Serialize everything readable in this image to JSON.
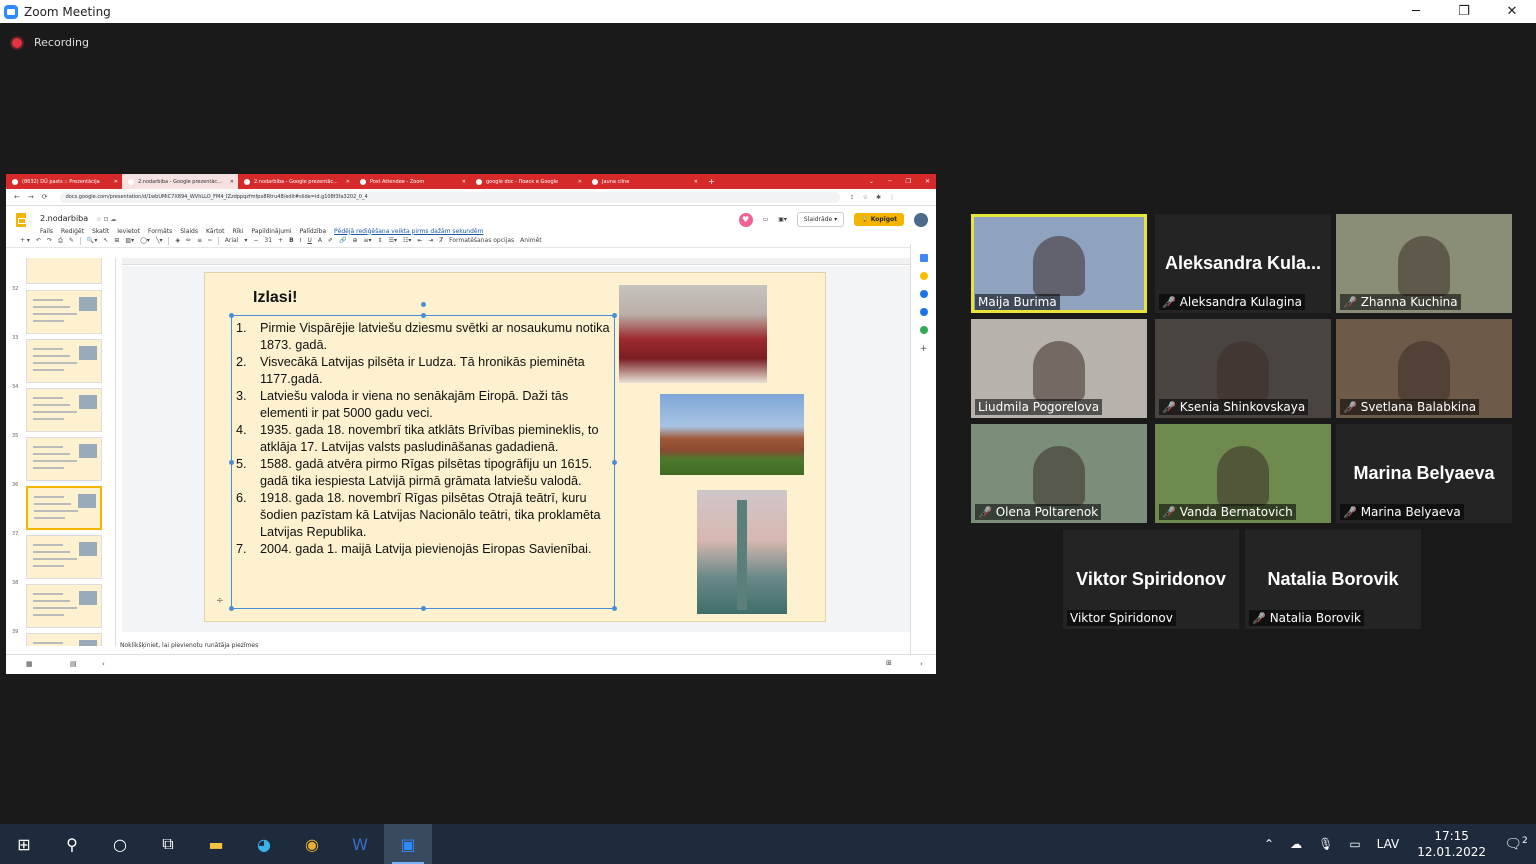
{
  "window": {
    "title": "Zoom Meeting",
    "minimize": "─",
    "restore": "❐",
    "close": "✕"
  },
  "recording": {
    "label": "Recording"
  },
  "browser": {
    "tabs": [
      {
        "label": "(8632) DŪ pasts :: Prezentācija",
        "active": false
      },
      {
        "label": "2.nodarbiba - Google prezentāc...",
        "active": true
      },
      {
        "label": "2.nodarbiba - Google prezentāc...",
        "active": false
      },
      {
        "label": "Post Attendee - Zoom",
        "active": false
      },
      {
        "label": "google doc - Поиск в Google",
        "active": false
      },
      {
        "label": "Jauna cilne",
        "active": false
      }
    ],
    "new_tab": "+",
    "url": "docs.google.com/presentation/d/1wbUMiC7X894_WVhLLO_FM4_IZzdppqzfmfpx8Rtru48/edit#slide=id.g108f3fa3202_0_4"
  },
  "doc": {
    "name": "2.nodarbiba",
    "menus": [
      "Fails",
      "Rediģēt",
      "Skatīt",
      "Ievietot",
      "Formāts",
      "Slaids",
      "Kārtot",
      "Rīki",
      "Papildinājumi",
      "Palīdzība"
    ],
    "last_edit": "Pēdējā rediģēšana veikta pirms dažām sekundēm",
    "slideshow_label": "Slaidrāde",
    "share_label": "Kopīgot",
    "toolbar": {
      "font": "Arial",
      "size": "31",
      "format_options": "Formatēšanas opcijas",
      "animate": "Animēt"
    },
    "notes_placeholder": "Noklikšķiniet, lai pievienotu runātāja piezīmes",
    "thumb_numbers": [
      "32",
      "33",
      "34",
      "35",
      "36",
      "37",
      "38",
      "39"
    ]
  },
  "slide": {
    "title": "Izlasi!",
    "items": [
      {
        "n": "1.",
        "text": "Pirmie Vispārējie latviešu dziesmu svētki ar nosaukumu notika 1873. gadā."
      },
      {
        "n": "2.",
        "text": "Visvecākā Latvijas pilsēta ir Ludza. Tā hronikās pieminēta 1177.gadā."
      },
      {
        "n": "3.",
        "text": "Latviešu valoda ir viena no senākajām Eiropā. Daži tās elementi ir pat 5000 gadu veci."
      },
      {
        "n": "4.",
        "text": "1935. gada 18. novembrī tika atklāts Brīvības piemineklis, to atklāja 17. Latvijas valsts pasludināšanas gadadienā."
      },
      {
        "n": "5.",
        "text": "1588. gadā atvēra pirmo Rīgas pilsētas tipogrāfiju un 1615. gadā tika iespiesta Latvijā pirmā grāmata latviešu valodā."
      },
      {
        "n": "6.",
        "text": "1918. gada 18. novembrī Rīgas pilsētas Otrajā teātrī, kuru šodien pazīstam kā Latvijas Nacionālo teātri, tika proklamēta Latvijas Republika."
      },
      {
        "n": "7.",
        "text": "2004. gada 1. maijā Latvija pievienojās Eiropas Savienībai."
      }
    ]
  },
  "participants": [
    {
      "name": "Maija Burima",
      "big": "",
      "muted": false,
      "active": true,
      "bg": "#8fa3c0"
    },
    {
      "name": "Aleksandra Kulagina",
      "big": "Aleksandra  Kula...",
      "muted": true,
      "active": false,
      "bg": "#242424"
    },
    {
      "name": "Zhanna Kuchina",
      "big": "",
      "muted": true,
      "active": false,
      "bg": "#8a8e76"
    },
    {
      "name": "Liudmila Pogorelova",
      "big": "",
      "muted": false,
      "active": false,
      "bg": "#b8b2ac"
    },
    {
      "name": "Ksenia Shinkovskaya",
      "big": "",
      "muted": true,
      "active": false,
      "bg": "#4a4440"
    },
    {
      "name": "Svetlana Balabkina",
      "big": "",
      "muted": true,
      "active": false,
      "bg": "#6e5a48"
    },
    {
      "name": "Olena Poltarenok",
      "big": "",
      "muted": true,
      "active": false,
      "bg": "#7a8e7a"
    },
    {
      "name": "Vanda Bernatovich",
      "big": "",
      "muted": true,
      "active": false,
      "bg": "#6e8a4e"
    },
    {
      "name": "Marina Belyaeva",
      "big": "Marina Belyaeva",
      "muted": true,
      "active": false,
      "bg": "#242424"
    },
    {
      "name": "Viktor Spiridonov",
      "big": "Viktor Spiridonov",
      "muted": false,
      "active": false,
      "bg": "#242424"
    },
    {
      "name": "Natalia Borovik",
      "big": "Natalia Borovik",
      "muted": true,
      "active": false,
      "bg": "#242424"
    }
  ],
  "taskbar": {
    "language": "LAV",
    "time": "17:15",
    "date": "12.01.2022",
    "notifications": "2"
  }
}
